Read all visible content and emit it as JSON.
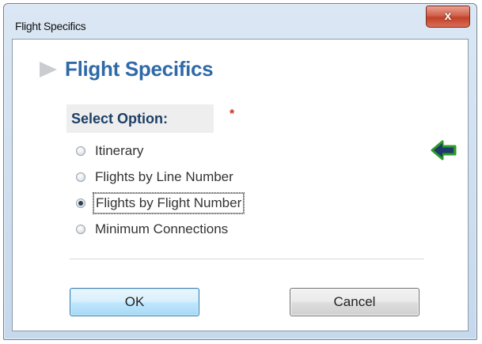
{
  "window": {
    "title": "Flight Specifics",
    "close_glyph": "x"
  },
  "header": {
    "title": "Flight Specifics",
    "icon": "chevron-right-icon"
  },
  "form": {
    "select_label": "Select Option:",
    "required_marker": "*",
    "options": [
      {
        "label": "Itinerary",
        "checked": false
      },
      {
        "label": "Flights by Line Number",
        "checked": false
      },
      {
        "label": "Flights by Flight Number",
        "checked": true
      },
      {
        "label": "Minimum Connections",
        "checked": false
      }
    ],
    "back_icon": "back-arrow-icon"
  },
  "buttons": {
    "ok_label": "OK",
    "cancel_label": "Cancel"
  },
  "colors": {
    "title_blue": "#2f6aa7",
    "label_navy": "#1d3f66",
    "required_red": "#d62a1c",
    "arrow_green": "#2f9a2a",
    "arrow_navy": "#1c3a6b"
  }
}
